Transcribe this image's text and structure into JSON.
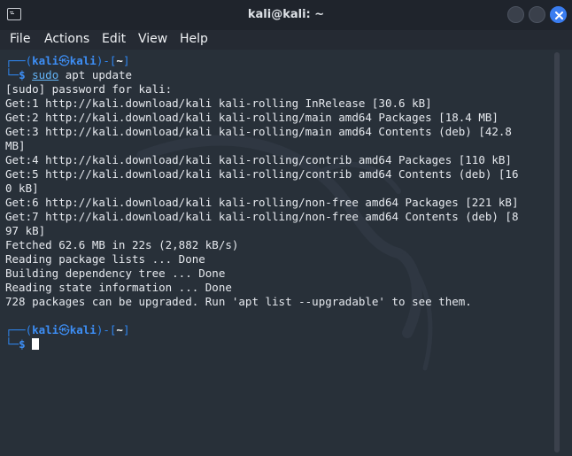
{
  "window": {
    "title": "kali@kali: ~"
  },
  "menu": [
    "File",
    "Actions",
    "Edit",
    "View",
    "Help"
  ],
  "prompt": {
    "frame_top_left": "┌──(",
    "user": "kali",
    "at_symbol": "㉿",
    "host": "kali",
    "frame_mid": ")-[",
    "dir": "~",
    "frame_end": "]",
    "frame_bottom": "└─",
    "sigil": "$"
  },
  "command": {
    "sudo": "sudo",
    "rest": " apt update"
  },
  "output": [
    "[sudo] password for kali:",
    "Get:1 http://kali.download/kali kali-rolling InRelease [30.6 kB]",
    "Get:2 http://kali.download/kali kali-rolling/main amd64 Packages [18.4 MB]",
    "Get:3 http://kali.download/kali kali-rolling/main amd64 Contents (deb) [42.8",
    "MB]",
    "Get:4 http://kali.download/kali kali-rolling/contrib amd64 Packages [110 kB]",
    "Get:5 http://kali.download/kali kali-rolling/contrib amd64 Contents (deb) [16",
    "0 kB]",
    "Get:6 http://kali.download/kali kali-rolling/non-free amd64 Packages [221 kB]",
    "Get:7 http://kali.download/kali kali-rolling/non-free amd64 Contents (deb) [8",
    "97 kB]",
    "Fetched 62.6 MB in 22s (2,882 kB/s)",
    "Reading package lists ... Done",
    "Building dependency tree ... Done",
    "Reading state information ... Done",
    "728 packages can be upgraded. Run 'apt list --upgradable' to see them.",
    ""
  ]
}
